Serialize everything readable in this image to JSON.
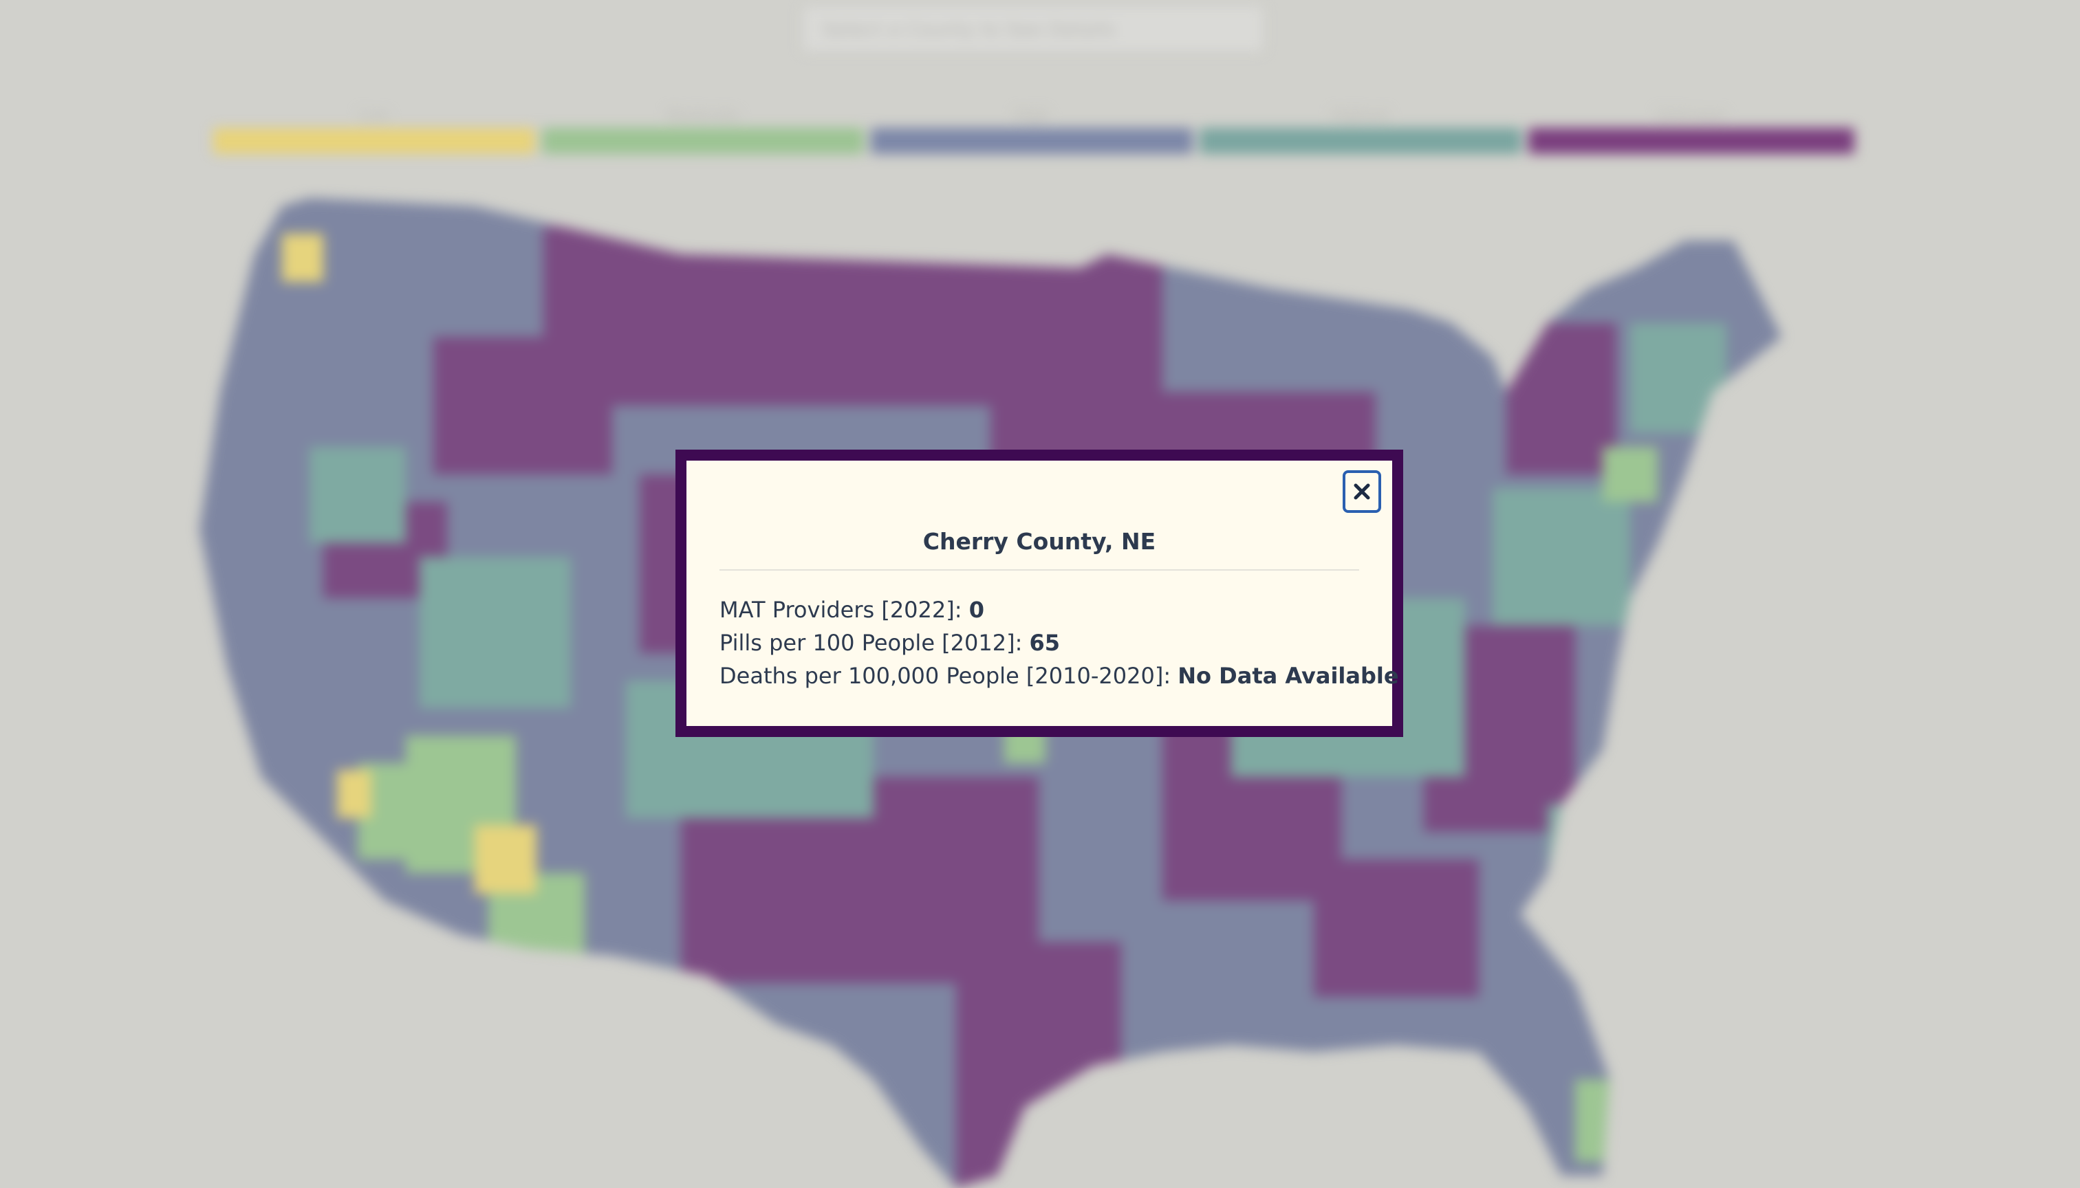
{
  "search": {
    "placeholder": "Select a County to See Details"
  },
  "legend": {
    "items": [
      {
        "label": "Low",
        "color": "#e8d37a"
      },
      {
        "label": "Moderate",
        "color": "#9cc493"
      },
      {
        "label": "High",
        "color": "#7c87a8"
      },
      {
        "label": "Highest",
        "color": "#7aa5a0"
      },
      {
        "label": "Unknown",
        "color": "#7a3e7e"
      }
    ]
  },
  "map": {
    "colors": {
      "purple": "#7b4b82",
      "slate": "#7e86a2",
      "teal": "#7faaa2",
      "green": "#9dc693",
      "yellow": "#e6d47d"
    }
  },
  "modal": {
    "close_icon": "close-icon",
    "county_name": "Cherry County, NE",
    "stats": [
      {
        "label": "MAT Providers [2022]: ",
        "value": "0"
      },
      {
        "label": "Pills per 100 People [2012]: ",
        "value": "65"
      },
      {
        "label": "Deaths per 100,000 People [2010-2020]: ",
        "value": "No Data Available"
      }
    ],
    "border_color": "#3e0a52",
    "background_color": "#fffbee"
  }
}
